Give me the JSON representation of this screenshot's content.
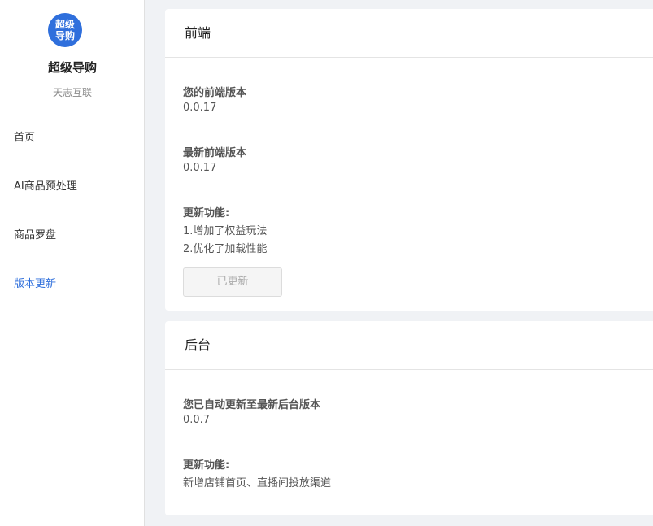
{
  "sidebar": {
    "logo_text": "超级\n导购",
    "title": "超级导购",
    "subtitle": "天志互联",
    "items": [
      {
        "label": "首页"
      },
      {
        "label": "AI商品预处理"
      },
      {
        "label": "商品罗盘"
      },
      {
        "label": "版本更新",
        "active": true
      }
    ]
  },
  "frontend": {
    "header": "前端",
    "your_version_label": "您的前端版本",
    "your_version": "0.0.17",
    "latest_version_label": "最新前端版本",
    "latest_version": "0.0.17",
    "features_label": "更新功能:",
    "features": [
      "1.增加了权益玩法",
      "2.优化了加载性能"
    ],
    "button_label": "已更新"
  },
  "backend": {
    "header": "后台",
    "auto_update_label": "您已自动更新至最新后台版本",
    "version": "0.0.7",
    "features_label": "更新功能:",
    "features": [
      "新增店铺首页、直播间投放渠道"
    ]
  },
  "colors": {
    "accent": "#2f6fdc",
    "background": "#f0f2f5"
  }
}
